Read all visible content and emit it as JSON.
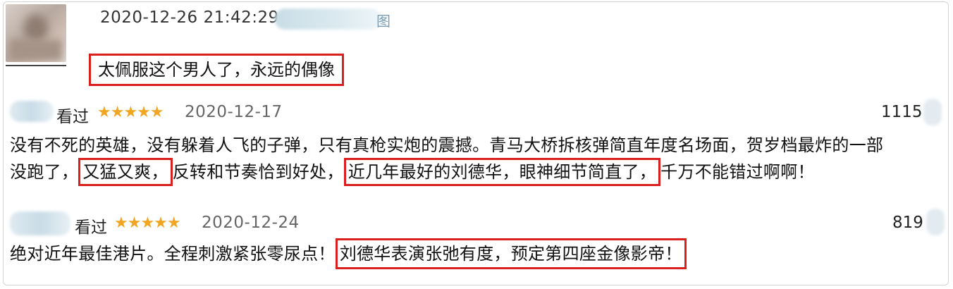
{
  "top_comment": {
    "timestamp": "2020-12-26 21:42:29",
    "text": "太佩服这个男人了，永远的偶像"
  },
  "reviews": [
    {
      "status": "看过",
      "stars": "★★★★★",
      "date": "2020-12-17",
      "votes": "1115",
      "line1": "没有不死的英雄，没有躲着人飞的子弹，只有真枪实炮的震撼。青马大桥拆核弹简直年度名场面，贺岁档最炸的一部",
      "line2_a": "没跑了，",
      "line2_box1": "又猛又爽，",
      "line2_b": "反转和节奏恰到好处，",
      "line2_box2": "近几年最好的刘德华，眼神细节简直了，",
      "line2_c": "千万不能错过啊啊！"
    },
    {
      "status": "看过",
      "stars": "★★★★★",
      "date": "2020-12-24",
      "votes": "819",
      "line1_a": "绝对近年最佳港片。全程刺激紧张零尿点！",
      "line1_box": "刘德华表演张弛有度，预定第四座金像影帝！"
    }
  ],
  "colors": {
    "highlight_box": "#d9201f",
    "star": "#f0a622"
  }
}
